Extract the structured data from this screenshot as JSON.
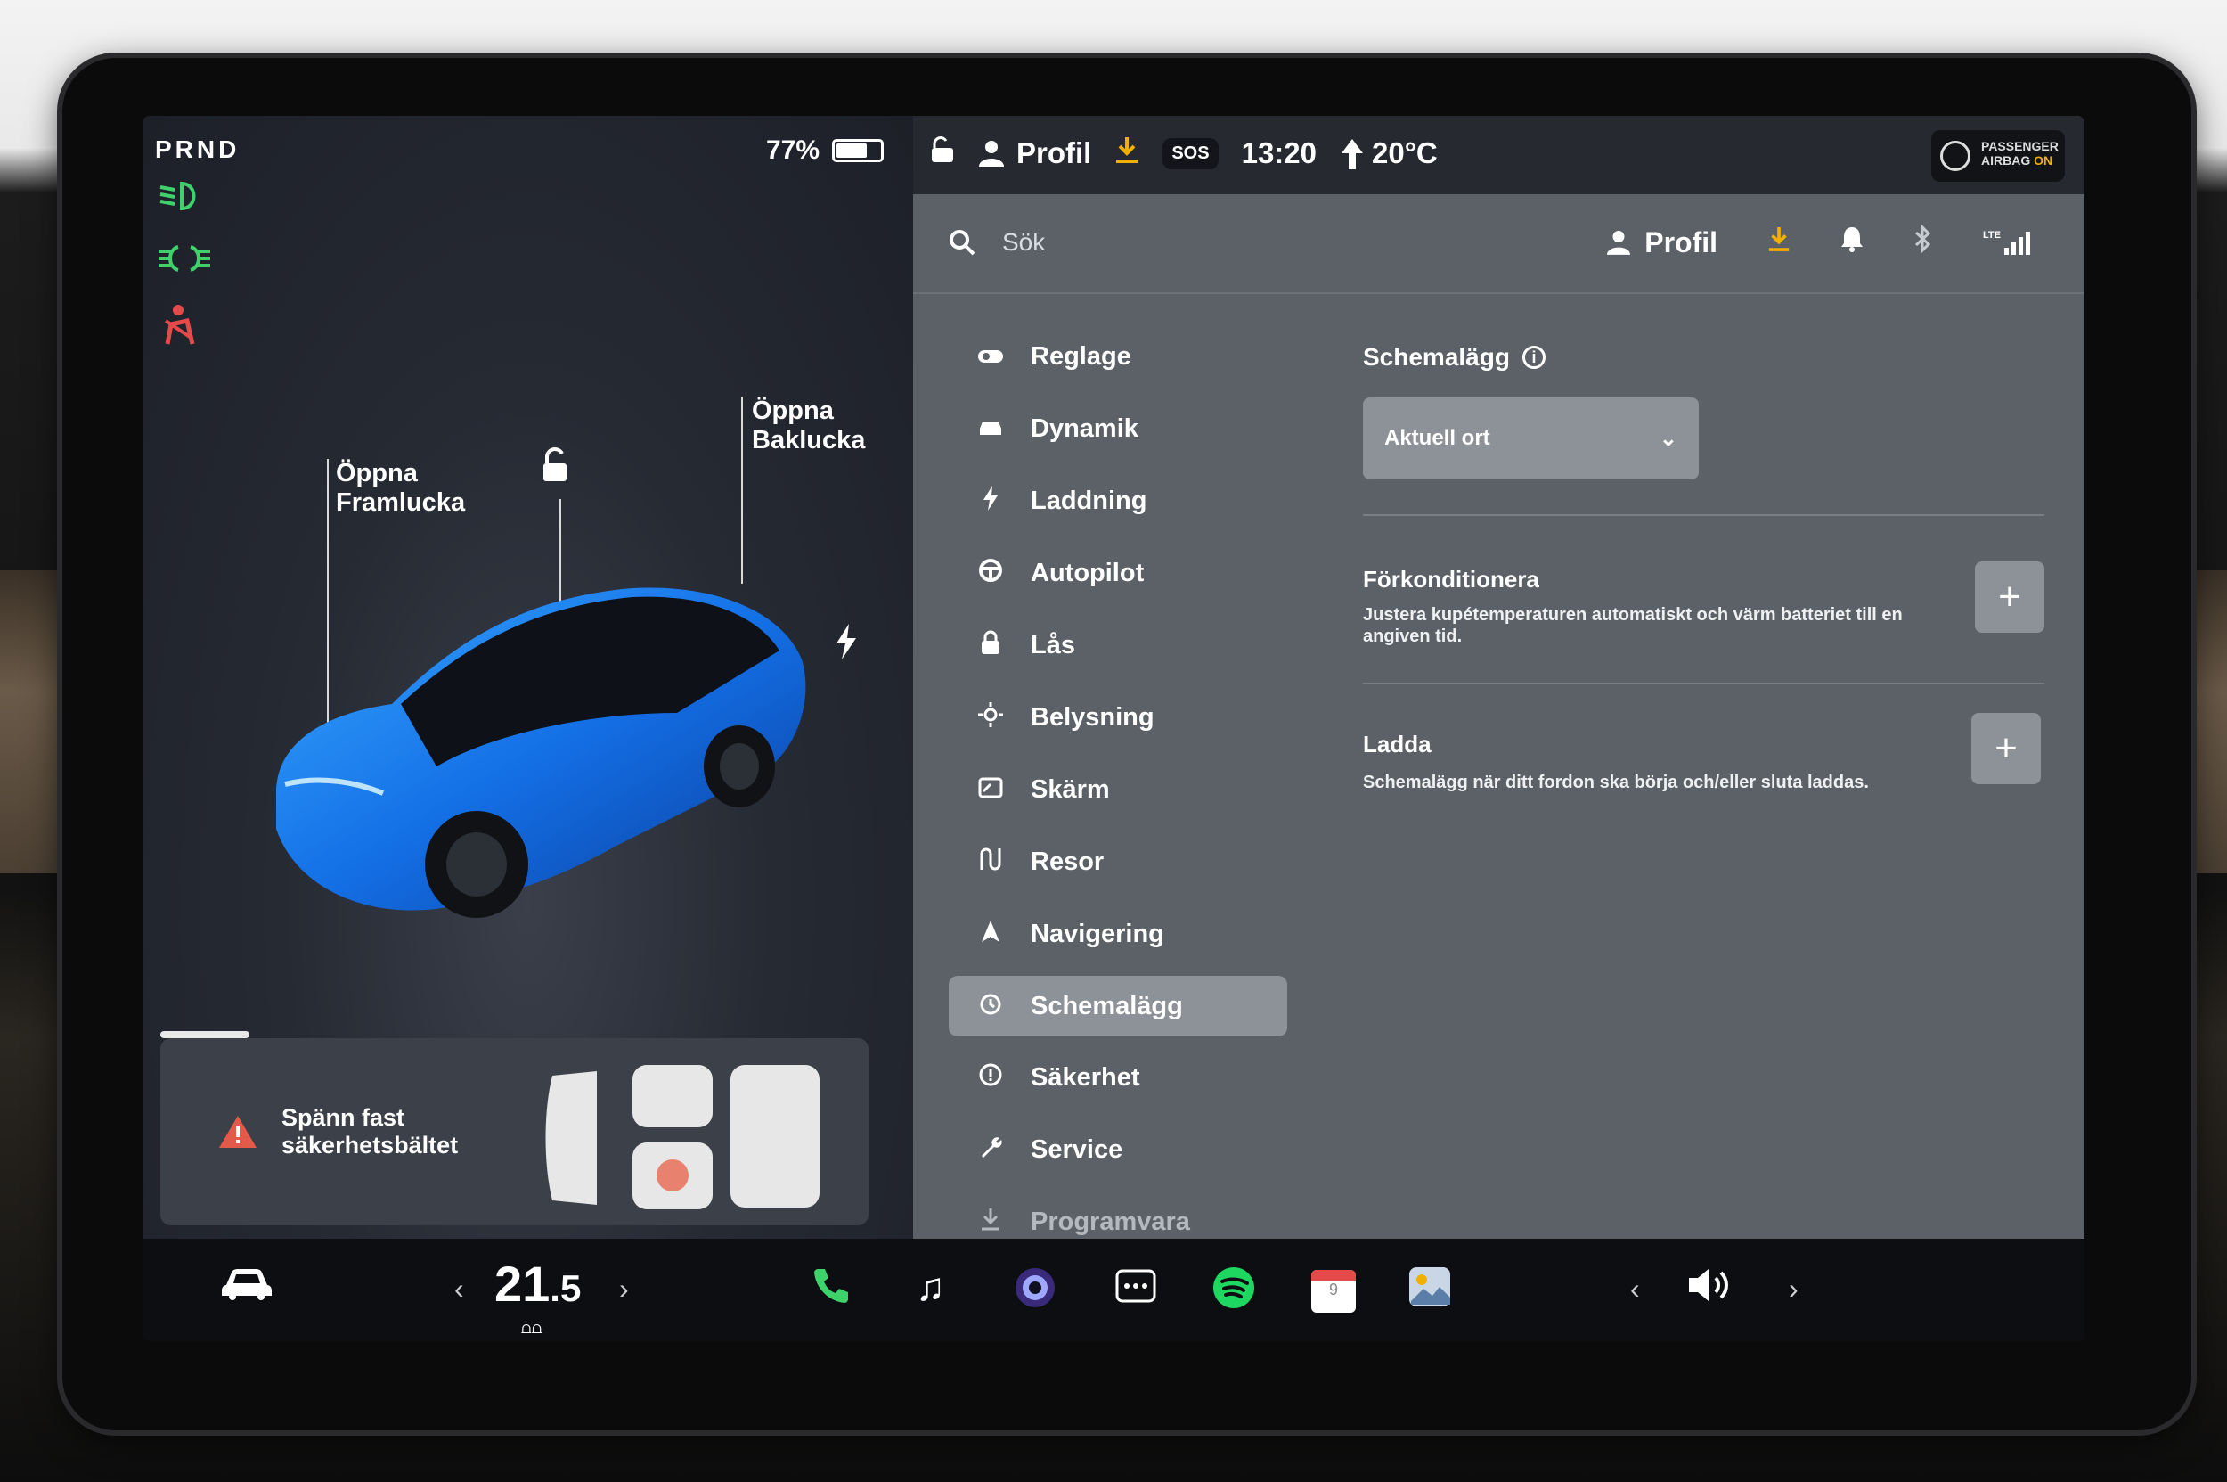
{
  "left": {
    "gear": "PRND",
    "battery_percent": "77%",
    "battery_level": 0.77,
    "callouts": {
      "frunk": "Öppna\nFramlucka",
      "trunk": "Öppna\nBaklucka"
    },
    "alert": {
      "text": "Spänn fast\nsäkerhetsbältet"
    }
  },
  "status": {
    "profile": "Profil",
    "sos": "SOS",
    "time": "13:20",
    "outside_temp": "20°C",
    "airbag_line1": "PASSENGER",
    "airbag_line2": "AIRBAG",
    "airbag_state": "ON"
  },
  "topbar": {
    "search_placeholder": "Sök",
    "profile": "Profil",
    "lte": "LTE"
  },
  "menu": [
    {
      "label": "Reglage",
      "icon": "toggle-icon"
    },
    {
      "label": "Dynamik",
      "icon": "car-icon"
    },
    {
      "label": "Laddning",
      "icon": "bolt-icon"
    },
    {
      "label": "Autopilot",
      "icon": "steering-wheel-icon"
    },
    {
      "label": "Lås",
      "icon": "lock-icon"
    },
    {
      "label": "Belysning",
      "icon": "sun-icon"
    },
    {
      "label": "Skärm",
      "icon": "display-icon"
    },
    {
      "label": "Resor",
      "icon": "trips-icon"
    },
    {
      "label": "Navigering",
      "icon": "navigation-icon"
    },
    {
      "label": "Schemalägg",
      "icon": "alarm-clock-icon",
      "selected": true
    },
    {
      "label": "Säkerhet",
      "icon": "alert-circle-icon"
    },
    {
      "label": "Service",
      "icon": "wrench-icon"
    },
    {
      "label": "Programvara",
      "icon": "download-icon"
    }
  ],
  "schedule": {
    "title": "Schemalägg",
    "location": "Aktuell ort",
    "precondition_title": "Förkonditionera",
    "precondition_desc": "Justera kupétemperaturen automatiskt och värm batteriet till en angiven tid.",
    "charge_title": "Ladda",
    "charge_desc": "Schemalägg när ditt fordon ska börja och/eller sluta laddas."
  },
  "taskbar": {
    "cabin_temp_int": "21",
    "cabin_temp_dec": ".5",
    "calendar_day": "9"
  }
}
